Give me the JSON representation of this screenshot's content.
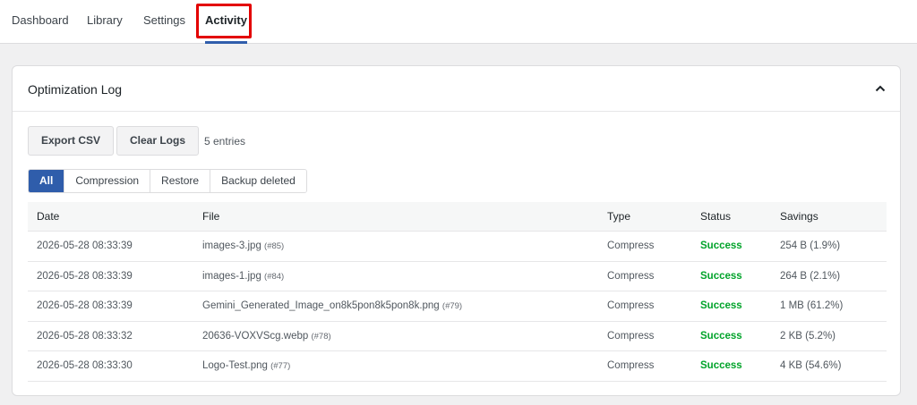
{
  "nav": {
    "tabs": [
      {
        "label": "Dashboard",
        "active": false
      },
      {
        "label": "Library",
        "active": false
      },
      {
        "label": "Settings",
        "active": false
      },
      {
        "label": "Activity",
        "active": true
      }
    ]
  },
  "panel": {
    "title": "Optimization Log",
    "toolbar": {
      "export_label": "Export CSV",
      "clear_label": "Clear Logs",
      "entries_text": "5 entries"
    },
    "filters": [
      {
        "label": "All",
        "active": true
      },
      {
        "label": "Compression",
        "active": false
      },
      {
        "label": "Restore",
        "active": false
      },
      {
        "label": "Backup deleted",
        "active": false
      }
    ],
    "table": {
      "columns": [
        "Date",
        "File",
        "Type",
        "Status",
        "Savings"
      ],
      "rows": [
        {
          "date": "2026-05-28 08:33:39",
          "file": "images-3.jpg",
          "id": "(#85)",
          "type": "Compress",
          "status": "Success",
          "savings": "254 B (1.9%)"
        },
        {
          "date": "2026-05-28 08:33:39",
          "file": "images-1.jpg",
          "id": "(#84)",
          "type": "Compress",
          "status": "Success",
          "savings": "264 B (2.1%)"
        },
        {
          "date": "2026-05-28 08:33:39",
          "file": "Gemini_Generated_Image_on8k5pon8k5pon8k.png",
          "id": "(#79)",
          "type": "Compress",
          "status": "Success",
          "savings": "1 MB (61.2%)"
        },
        {
          "date": "2026-05-28 08:33:32",
          "file": "20636-VOXVScg.webp",
          "id": "(#78)",
          "type": "Compress",
          "status": "Success",
          "savings": "2 KB (5.2%)"
        },
        {
          "date": "2026-05-28 08:33:30",
          "file": "Logo-Test.png",
          "id": "(#77)",
          "type": "Compress",
          "status": "Success",
          "savings": "4 KB (54.6%)"
        }
      ]
    }
  },
  "colors": {
    "accent": "#2f5dab",
    "success": "#00a32a",
    "highlight": "#e30000"
  },
  "icons": {
    "collapse": "chevron-up-icon"
  }
}
